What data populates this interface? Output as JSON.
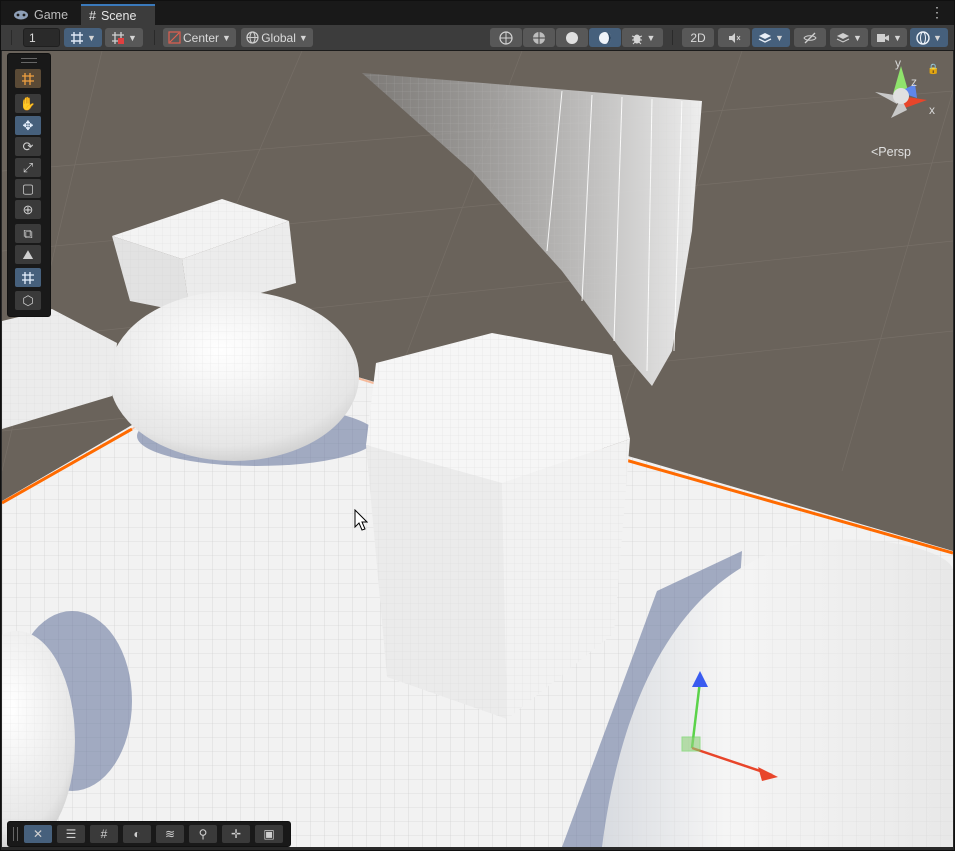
{
  "tabs": {
    "game_label": "Game",
    "scene_label": "Scene"
  },
  "toolbar": {
    "layer_value": "1",
    "pivot_mode": "Center",
    "pivot_rotation": "Global",
    "view_2d_label": "2D"
  },
  "gizmo": {
    "axis_x": "x",
    "axis_y": "y",
    "axis_z": "z",
    "projection_label": "<Persp"
  },
  "tools": {
    "items": [
      "grid-snap",
      "hand",
      "move",
      "rotate",
      "scale",
      "rect",
      "transform",
      "create",
      "terrain",
      "probuilder",
      "lod"
    ]
  },
  "bottom_tools": {
    "items": [
      "tools",
      "settings",
      "grid",
      "shading",
      "layers",
      "search",
      "transform",
      "camera"
    ]
  },
  "colors": {
    "accent": "#46607c",
    "selection_outline": "#ff6a00",
    "ground": "#f0f0f0",
    "sky": "#6a635b"
  }
}
